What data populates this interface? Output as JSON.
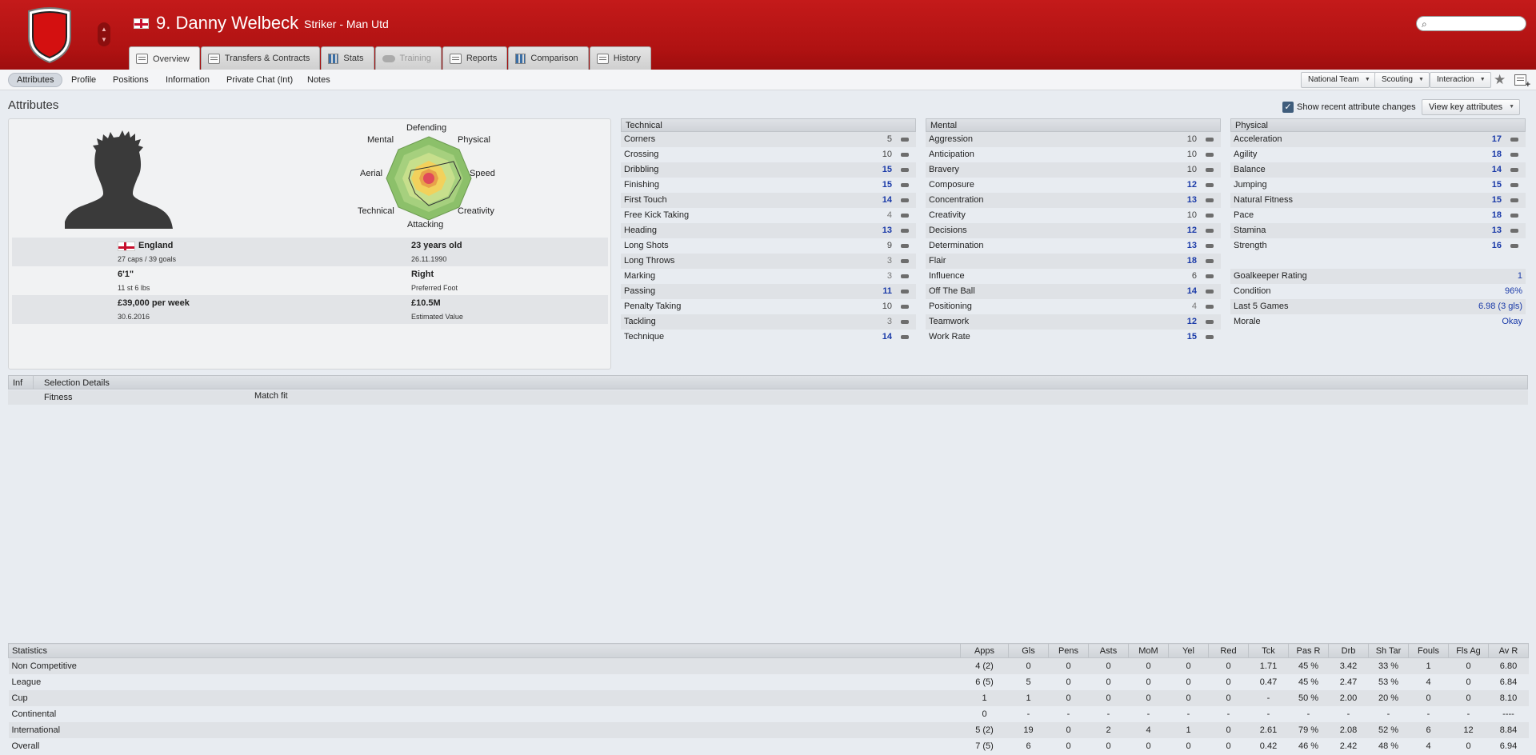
{
  "header": {
    "name": "9. Danny Welbeck",
    "subtitle": "Striker - Man Utd",
    "search_placeholder": "",
    "tabs": [
      {
        "label": "Overview",
        "icon": "profile-card-icon"
      },
      {
        "label": "Transfers & Contracts",
        "icon": "document-icon"
      },
      {
        "label": "Stats",
        "icon": "bar-chart-icon"
      },
      {
        "label": "Training",
        "icon": "cloud-icon"
      },
      {
        "label": "Reports",
        "icon": "report-icon"
      },
      {
        "label": "Comparison",
        "icon": "comparison-icon"
      },
      {
        "label": "History",
        "icon": "history-icon"
      }
    ]
  },
  "subnav": {
    "items": [
      "Attributes",
      "Profile",
      "Positions",
      "Information",
      "Private Chat (Int)",
      "Notes"
    ],
    "dropdowns": [
      "National Team",
      "Scouting",
      "Interaction"
    ]
  },
  "attributes_section": {
    "title": "Attributes",
    "show_recent_label": "Show recent attribute changes",
    "key_attributes_button": "View key attributes"
  },
  "radar_labels": {
    "top": "Defending",
    "top_left": "Mental",
    "top_right": "Physical",
    "left": "Aerial",
    "right": "Speed",
    "bottom_left": "Technical",
    "bottom_right": "Creativity",
    "bottom": "Attacking"
  },
  "profile": {
    "nation": "England",
    "caps": "27 caps / 39 goals",
    "age": "23 years old",
    "dob": "26.11.1990",
    "height": "6'1\"",
    "weight": "11 st 6 lbs",
    "foot": "Right",
    "foot_label": "Preferred Foot",
    "wage": "£39,000 per week",
    "contract": "30.6.2016",
    "value": "£10.5M",
    "value_label": "Estimated Value"
  },
  "technical": {
    "title": "Technical",
    "rows": [
      {
        "name": "Corners",
        "value": "5"
      },
      {
        "name": "Crossing",
        "value": "10"
      },
      {
        "name": "Dribbling",
        "value": "15"
      },
      {
        "name": "Finishing",
        "value": "15"
      },
      {
        "name": "First Touch",
        "value": "14"
      },
      {
        "name": "Free Kick Taking",
        "value": "4"
      },
      {
        "name": "Heading",
        "value": "13"
      },
      {
        "name": "Long Shots",
        "value": "9"
      },
      {
        "name": "Long Throws",
        "value": "3"
      },
      {
        "name": "Marking",
        "value": "3"
      },
      {
        "name": "Passing",
        "value": "11"
      },
      {
        "name": "Penalty Taking",
        "value": "10"
      },
      {
        "name": "Tackling",
        "value": "3"
      },
      {
        "name": "Technique",
        "value": "14"
      }
    ]
  },
  "mental": {
    "title": "Mental",
    "rows": [
      {
        "name": "Aggression",
        "value": "10"
      },
      {
        "name": "Anticipation",
        "value": "10"
      },
      {
        "name": "Bravery",
        "value": "10"
      },
      {
        "name": "Composure",
        "value": "12"
      },
      {
        "name": "Concentration",
        "value": "13"
      },
      {
        "name": "Creativity",
        "value": "10"
      },
      {
        "name": "Decisions",
        "value": "12"
      },
      {
        "name": "Determination",
        "value": "13"
      },
      {
        "name": "Flair",
        "value": "18"
      },
      {
        "name": "Influence",
        "value": "6"
      },
      {
        "name": "Off The Ball",
        "value": "14"
      },
      {
        "name": "Positioning",
        "value": "4"
      },
      {
        "name": "Teamwork",
        "value": "12"
      },
      {
        "name": "Work Rate",
        "value": "15"
      }
    ]
  },
  "physical": {
    "title": "Physical",
    "rows": [
      {
        "name": "Acceleration",
        "value": "17"
      },
      {
        "name": "Agility",
        "value": "18"
      },
      {
        "name": "Balance",
        "value": "14"
      },
      {
        "name": "Jumping",
        "value": "15"
      },
      {
        "name": "Natural Fitness",
        "value": "15"
      },
      {
        "name": "Pace",
        "value": "18"
      },
      {
        "name": "Stamina",
        "value": "13"
      },
      {
        "name": "Strength",
        "value": "16"
      }
    ],
    "extra": [
      {
        "name": "Goalkeeper Rating",
        "value": "1"
      },
      {
        "name": "Condition",
        "value": "96%"
      },
      {
        "name": "Last 5 Games",
        "value": "6.98 (3 gls)"
      },
      {
        "name": "Morale",
        "value": "Okay"
      }
    ]
  },
  "selection": {
    "inf_header": "Inf",
    "title": "Selection Details",
    "row_label": "Fitness",
    "row_value": "Match fit"
  },
  "statistics": {
    "columns": [
      "Statistics",
      "Apps",
      "Gls",
      "Pens",
      "Asts",
      "MoM",
      "Yel",
      "Red",
      "Tck",
      "Pas R",
      "Drb",
      "Sh Tar",
      "Fouls",
      "Fls Ag",
      "Av R"
    ],
    "rows": [
      [
        "Non Competitive",
        "4 (2)",
        "0",
        "0",
        "0",
        "0",
        "0",
        "0",
        "1.71",
        "45 %",
        "3.42",
        "33 %",
        "1",
        "0",
        "6.80"
      ],
      [
        "League",
        "6 (5)",
        "5",
        "0",
        "0",
        "0",
        "0",
        "0",
        "0.47",
        "45 %",
        "2.47",
        "53 %",
        "4",
        "0",
        "6.84"
      ],
      [
        "Cup",
        "1",
        "1",
        "0",
        "0",
        "0",
        "0",
        "0",
        "-",
        "50 %",
        "2.00",
        "20 %",
        "0",
        "0",
        "8.10"
      ],
      [
        "Continental",
        "0",
        "-",
        "-",
        "-",
        "-",
        "-",
        "-",
        "-",
        "-",
        "-",
        "-",
        "-",
        "-",
        "----"
      ],
      [
        "International",
        "5 (2)",
        "19",
        "0",
        "2",
        "4",
        "1",
        "0",
        "2.61",
        "79 %",
        "2.08",
        "52 %",
        "6",
        "12",
        "8.84"
      ],
      [
        "Overall",
        "7 (5)",
        "6",
        "0",
        "0",
        "0",
        "0",
        "0",
        "0.42",
        "46 %",
        "2.42",
        "48 %",
        "4",
        "0",
        "6.94"
      ]
    ]
  },
  "colors": {
    "header_red": "#b01212",
    "value_blue": "#1a3aa8"
  }
}
